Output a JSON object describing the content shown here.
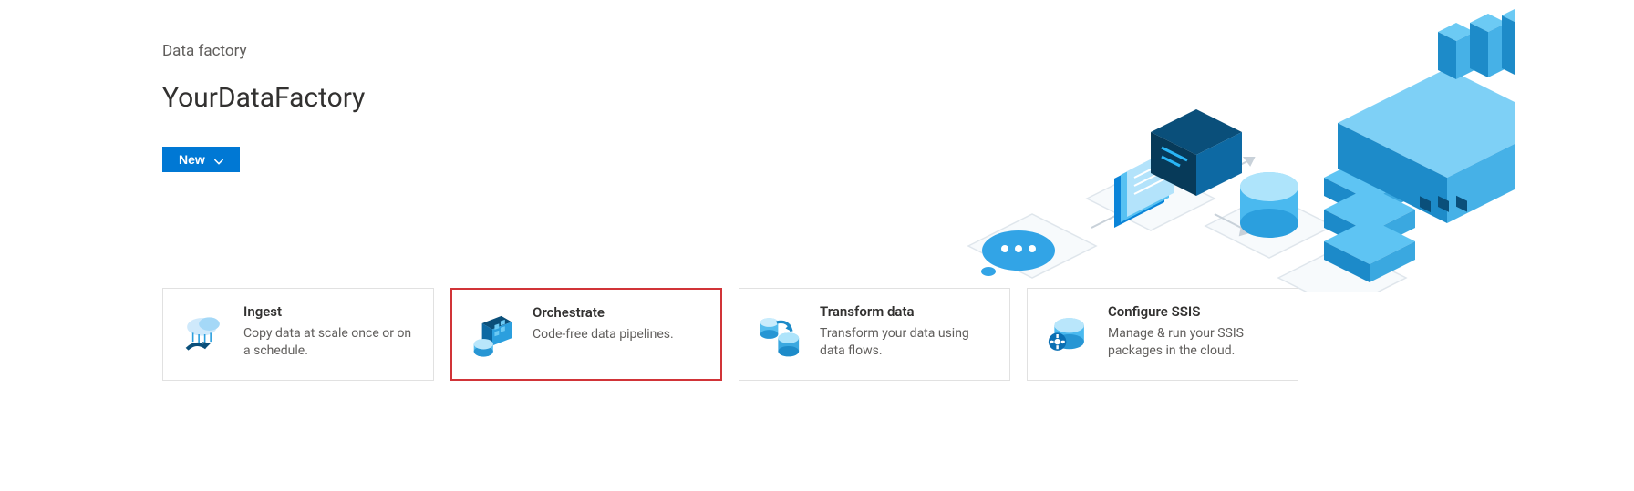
{
  "breadcrumb": "Data factory",
  "title": "YourDataFactory",
  "new_button": {
    "label": "New"
  },
  "cards": [
    {
      "id": "ingest",
      "title": "Ingest",
      "desc": "Copy data at scale once or on a schedule.",
      "highlight": false
    },
    {
      "id": "orchestrate",
      "title": "Orchestrate",
      "desc": "Code-free data pipelines.",
      "highlight": true
    },
    {
      "id": "transform",
      "title": "Transform data",
      "desc": "Transform your data using data flows.",
      "highlight": false
    },
    {
      "id": "ssis",
      "title": "Configure SSIS",
      "desc": "Manage & run your SSIS packages in the cloud.",
      "highlight": false
    }
  ]
}
